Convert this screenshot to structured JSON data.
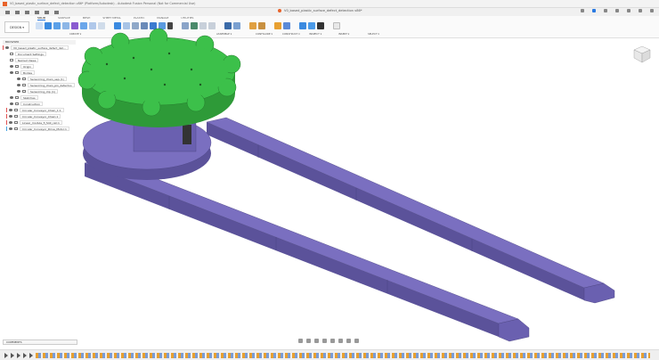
{
  "window": {
    "title": "V0_based_plastic_surface_defect_detection v86* (Platform/Autodesk) - Autodesk Fusion Personal (Not for Commercial Use)"
  },
  "document_tab": {
    "label": "V0_based_plastic_surface_defect_detection v86*"
  },
  "ribbon": {
    "workspace": "DESIGN ▾",
    "tabs": [
      "SOLID",
      "SURFACE",
      "MESH",
      "SHEET METAL",
      "PLASTIC",
      "MANAGE",
      "UTILITIES"
    ],
    "groups": [
      "CREATE ▾",
      "MODIFY ▾",
      "ASSEMBLE ▾",
      "CONFIGURE ▾",
      "CONSTRUCT ▾",
      "INSPECT ▾",
      "INSERT ▾",
      "SELECT ▾"
    ]
  },
  "browser": {
    "title": "BROWSER",
    "items": [
      {
        "label": "V0_based_plastic_surface_defect_det..."
      },
      {
        "label": "Document Settings"
      },
      {
        "label": "Named Views"
      },
      {
        "label": "Origin"
      },
      {
        "label": "Bodies"
      },
      {
        "label": "Sensorring_chain_sep (1)"
      },
      {
        "label": "Sensorring_chain_pin_defectno"
      },
      {
        "label": "Sensorring_clip (1)"
      },
      {
        "label": "Sketches"
      },
      {
        "label": "Construction"
      },
      {
        "label": "Circular_Conveyor_Chain_1:1"
      },
      {
        "label": "Circular_Conveyor_Chain:1"
      },
      {
        "label": "Linear_module_5_Slot_rail:1"
      },
      {
        "label": "Circular_Conveyor_Drive_Motor:1"
      }
    ]
  },
  "comments": {
    "label": "COMMENTS"
  },
  "colors": {
    "gear": "#3cc04a",
    "gear_side": "#2e9a38",
    "conveyor": "#7a6fc0",
    "conveyor_side": "#5b529a",
    "accent": "#2a7ae2"
  }
}
